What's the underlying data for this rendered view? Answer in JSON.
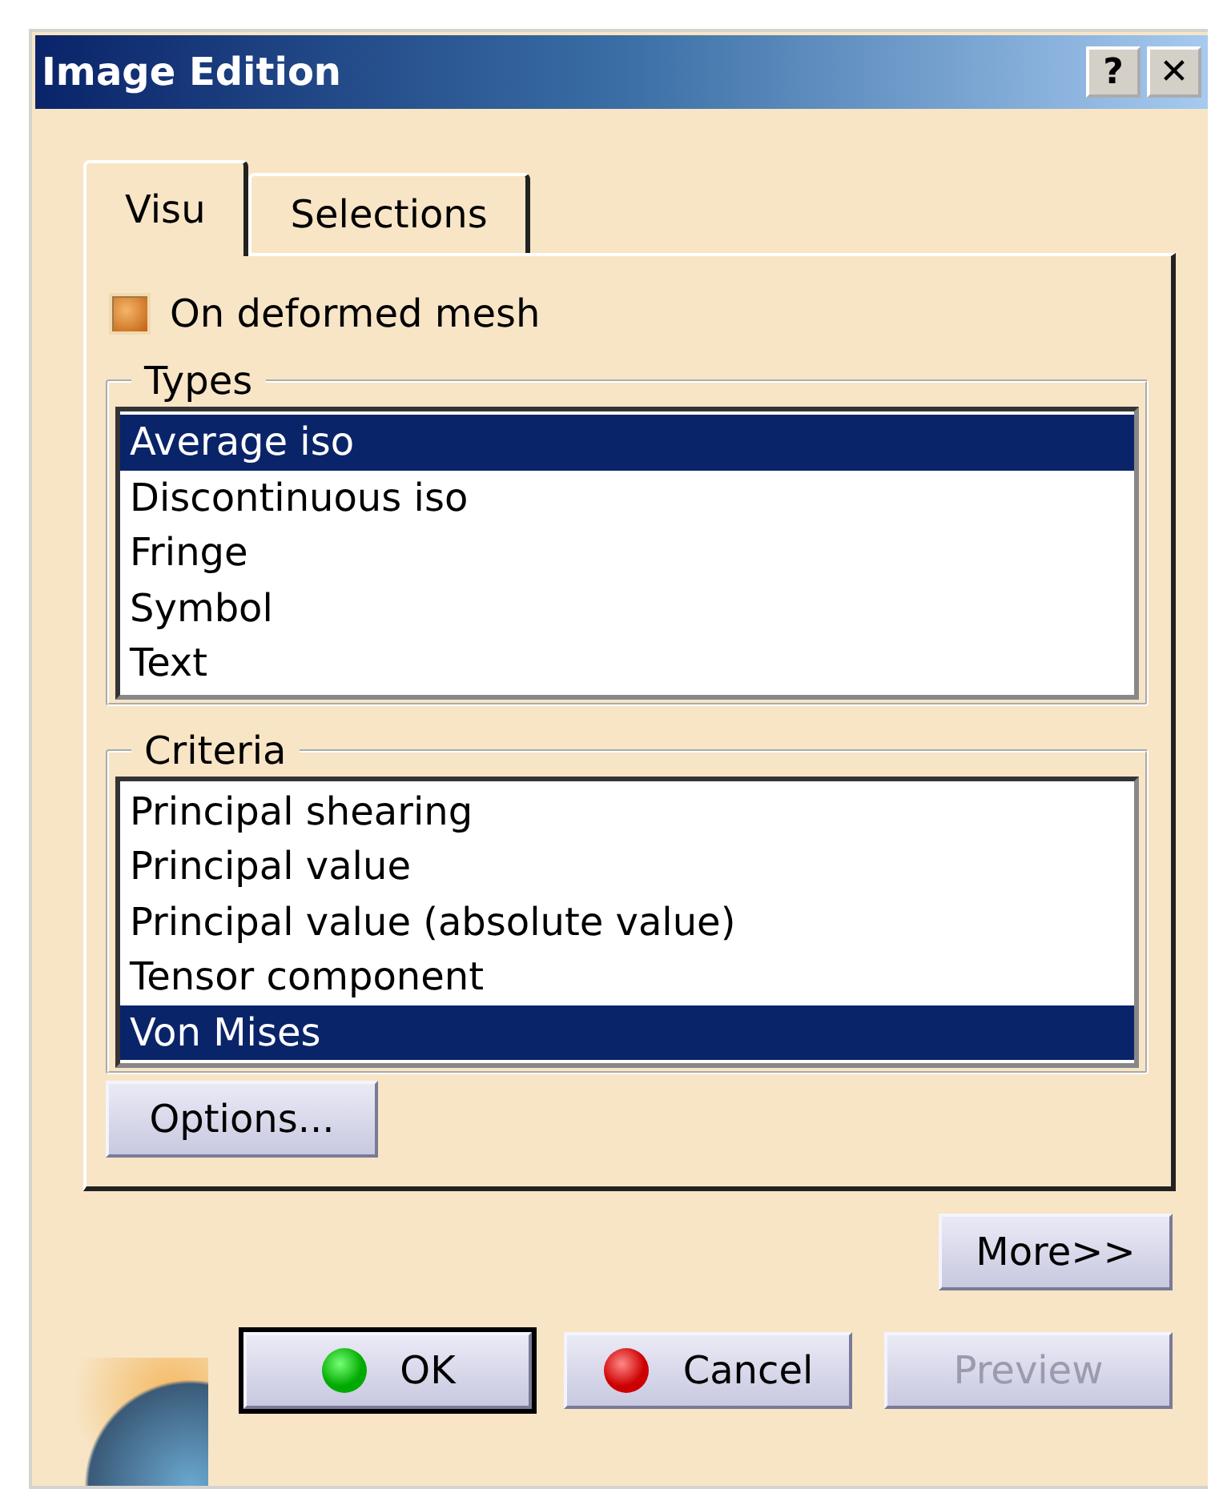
{
  "window": {
    "title": "Image Edition",
    "controls": [
      "?",
      "✕"
    ]
  },
  "tabs": [
    {
      "label": "Visu",
      "selected": true
    },
    {
      "label": "Selections",
      "selected": false
    }
  ],
  "checkbox": {
    "label": "On deformed mesh",
    "checked": true
  },
  "types": {
    "label": "Types",
    "items": [
      {
        "label": "Average iso",
        "selected": true
      },
      {
        "label": "Discontinuous iso",
        "selected": false
      },
      {
        "label": "Fringe",
        "selected": false
      },
      {
        "label": "Symbol",
        "selected": false
      },
      {
        "label": "Text",
        "selected": false
      }
    ]
  },
  "criteria": {
    "label": "Criteria",
    "items": [
      {
        "label": "Principal shearing",
        "selected": false
      },
      {
        "label": "Principal value",
        "selected": false
      },
      {
        "label": "Principal value (absolute value)",
        "selected": false
      },
      {
        "label": "Tensor component",
        "selected": false
      },
      {
        "label": "Von Mises",
        "selected": true
      }
    ]
  },
  "options_button": "Options...",
  "more_button": "More>>",
  "buttons": [
    {
      "label": "OK",
      "kind": "ok",
      "disabled": false,
      "default": true
    },
    {
      "label": "Cancel",
      "kind": "cancel",
      "disabled": false,
      "default": false
    },
    {
      "label": "Preview",
      "kind": "plain",
      "disabled": true,
      "default": false
    }
  ]
}
